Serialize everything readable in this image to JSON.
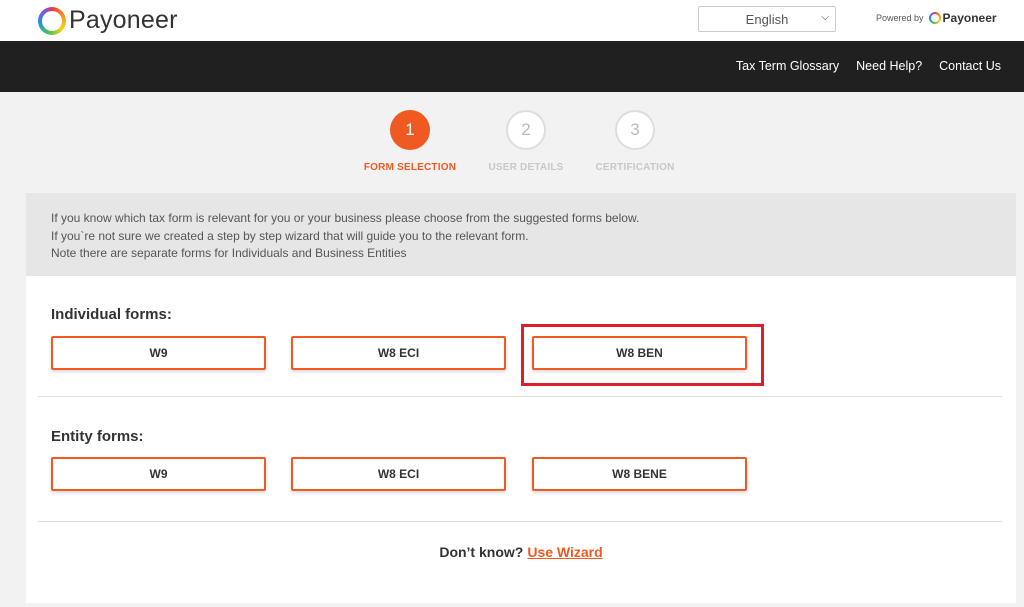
{
  "header": {
    "brand": "Payoneer",
    "language": {
      "selected": "English"
    },
    "powered_by": {
      "label": "Powered by",
      "brand": "Payoneer"
    }
  },
  "nav": {
    "links": [
      "Tax Term Glossary",
      "Need Help?",
      "Contact Us"
    ]
  },
  "steps": [
    {
      "number": "1",
      "label": "FORM SELECTION",
      "state": "active"
    },
    {
      "number": "2",
      "label": "USER DETAILS",
      "state": "inactive"
    },
    {
      "number": "3",
      "label": "CERTIFICATION",
      "state": "inactive"
    }
  ],
  "notice": {
    "lines": [
      "If you know which tax form is relevant for you or your business please choose from the suggested forms below.",
      "If you`re not sure we created a step by step wizard that will guide you to the relevant form.",
      "Note there are separate forms for Individuals and Business Entities"
    ]
  },
  "individual": {
    "title": "Individual forms:",
    "forms": [
      "W9",
      "W8 ECI",
      "W8 BEN"
    ]
  },
  "entity": {
    "title": "Entity forms:",
    "forms": [
      "W9",
      "W8 ECI",
      "W8 BENE"
    ]
  },
  "footer": {
    "question": "Don’t know?",
    "link": "Use Wizard"
  },
  "colors": {
    "accent": "#f05a22",
    "navbar": "#202020",
    "highlight": "#e01e2b"
  }
}
